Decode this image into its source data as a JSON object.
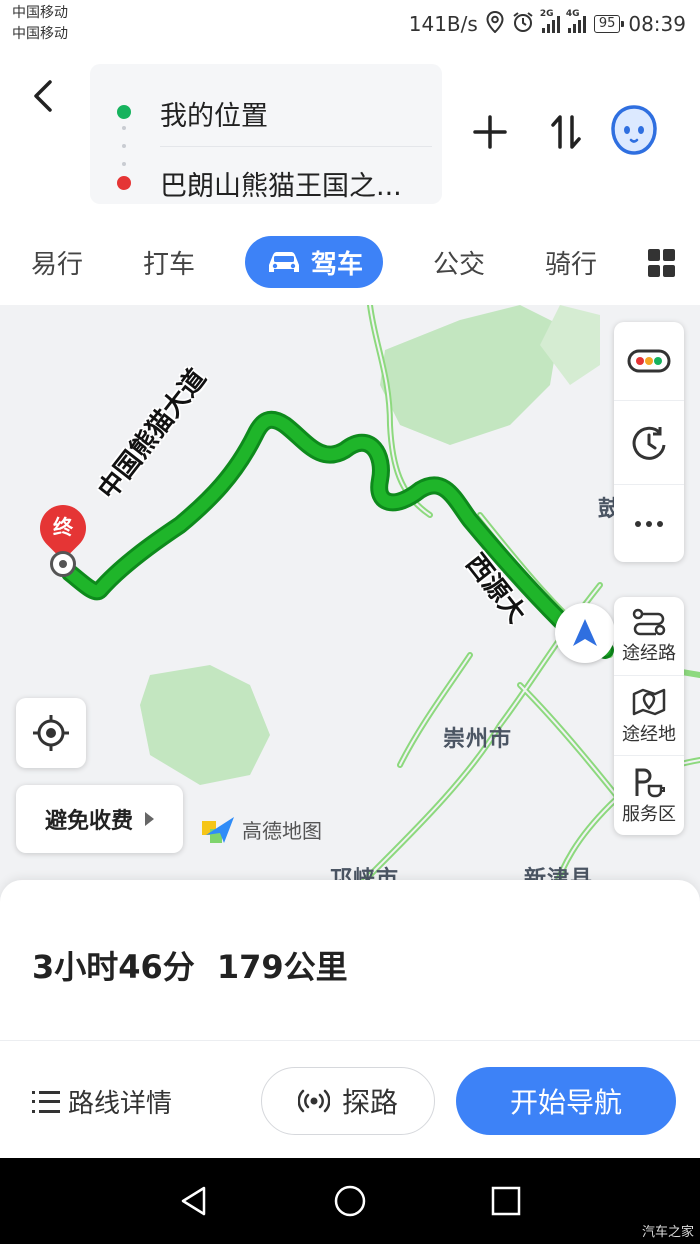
{
  "status_bar": {
    "carrier_1": "中国移动",
    "carrier_2": "中国移动",
    "speed": "141B/s",
    "net_1": "2G",
    "net_2": "4G",
    "battery": "95",
    "time": "08:39"
  },
  "route": {
    "start": "我的位置",
    "destination": "巴朗山熊猫王国之..."
  },
  "modes": {
    "tabs": [
      "易行",
      "打车",
      "驾车",
      "公交",
      "骑行"
    ],
    "active": "驾车"
  },
  "map": {
    "end_marker": "终",
    "road_1": "中国熊猫大道",
    "road_2": "西源大",
    "city_1": "崇州市",
    "city_2": "邛崃市",
    "city_3": "新津县",
    "edge_char": "鼓",
    "logo": "高德地图",
    "avoid_toll": "避免收费",
    "side_tools": {
      "waypoint_road": "途经路",
      "waypoint_place": "途经地",
      "service_area": "服务区"
    },
    "colors": {
      "route": "#1fb52a",
      "green_area": "#c3e6c0",
      "road": "#7fd46c"
    }
  },
  "summary": {
    "duration": "3小时46分",
    "distance": "179公里"
  },
  "actions": {
    "details": "路线详情",
    "explore": "探路",
    "start": "开始导航"
  },
  "watermark": "汽车之家"
}
